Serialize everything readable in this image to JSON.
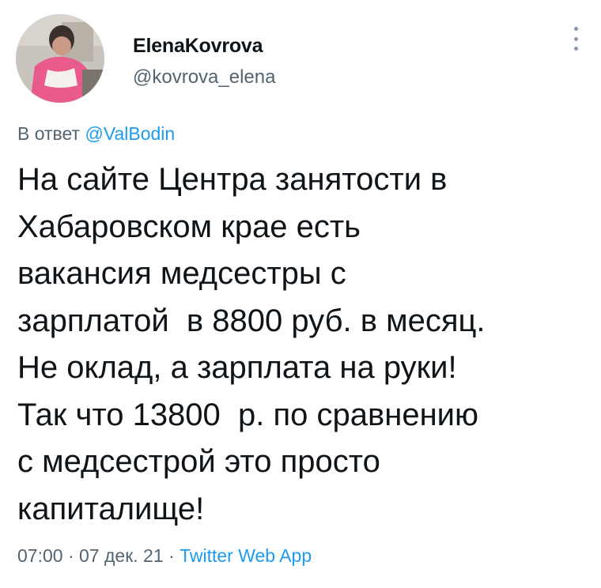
{
  "author": {
    "display_name": "ElenaKovrova",
    "handle": "@kovrova_elena"
  },
  "reply_to": {
    "prefix": "В ответ",
    "mention": "@ValBodin"
  },
  "tweet": {
    "lines": [
      "На сайте Центра занятости в",
      "Хабаровском крае есть",
      "вакансия медсестры с",
      "зарплатой  в 8800 руб. в месяц.",
      "Не оклад, а зарплата на руки!",
      "Так что 13800  р. по сравнению",
      "с медсестрой это просто",
      "капиталище!"
    ]
  },
  "meta": {
    "time": "07:00",
    "separator1": " · ",
    "date": "07 дек. 21",
    "separator2": " · ",
    "source": "Twitter Web App"
  },
  "icons": {
    "more": "more-vertical-icon",
    "avatar": "avatar"
  },
  "colors": {
    "text": "#0f1419",
    "secondary": "#536471",
    "link": "#1d9bf0"
  }
}
